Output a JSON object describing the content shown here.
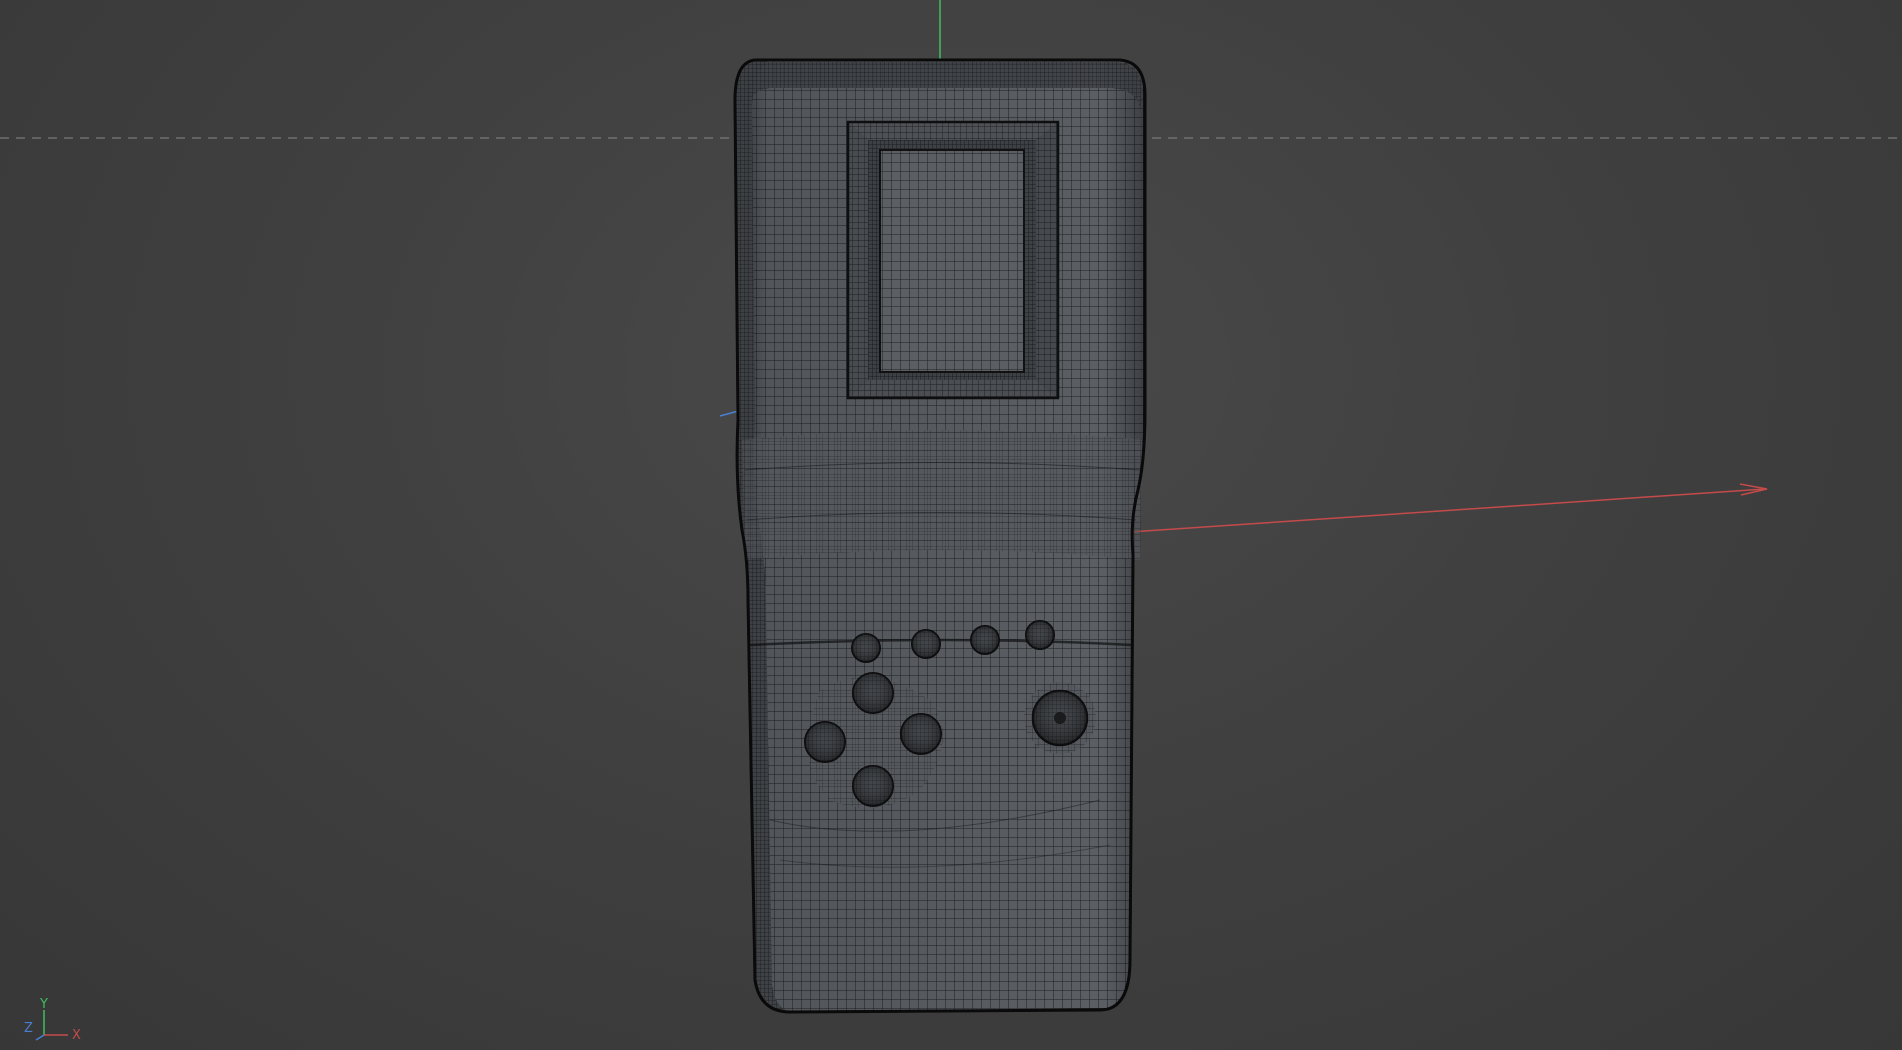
{
  "viewport": {
    "background": "#404040",
    "model": "handheld-game-console",
    "display_mode": "wireframe"
  },
  "colors": {
    "x_axis": "#c54a4a",
    "y_axis": "#3fbf5f",
    "z_axis": "#4a7fd0",
    "mesh_fill": "#5a5e63",
    "wire": "#1e1f21"
  },
  "gizmo": {
    "x_label": "X",
    "y_label": "Y",
    "z_label": "Z"
  }
}
